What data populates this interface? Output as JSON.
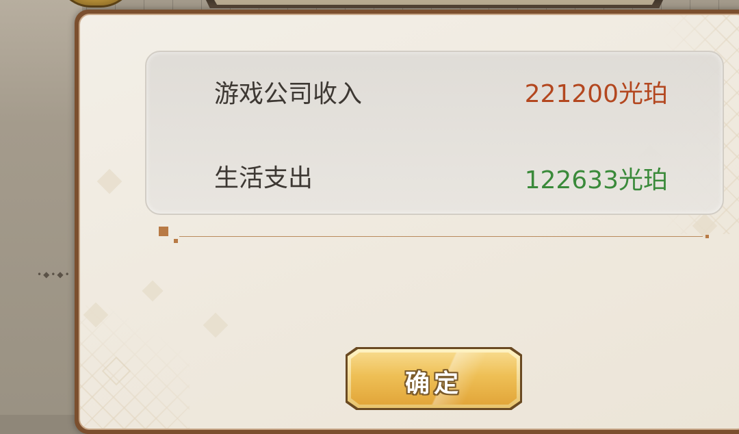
{
  "summary": {
    "income": {
      "label": "游戏公司收入",
      "value": "221200光珀"
    },
    "expense": {
      "label": "生活支出",
      "value": "122633光珀"
    }
  },
  "buttons": {
    "confirm_label": "确定"
  },
  "background": {
    "dots": "•◆•◆•"
  },
  "colors": {
    "income_value": "#b3471f",
    "expense_value": "#3a8a3a",
    "dialog_frame": "#7b4f2e",
    "button_gold": "#eebf55"
  },
  "icons": {
    "divider": "ornament-divider-icon",
    "medallion": "gold-medallion-icon"
  }
}
